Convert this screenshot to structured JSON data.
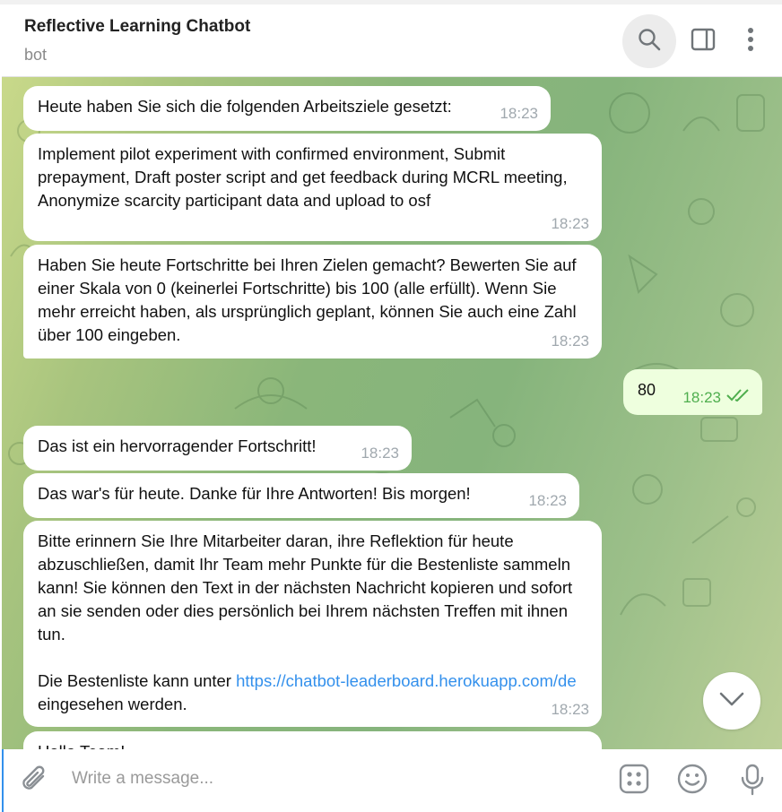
{
  "header": {
    "title": "Reflective Learning Chatbot",
    "subtitle": "bot",
    "icons": [
      "search-icon",
      "sidebar-toggle-icon",
      "more-options-icon"
    ]
  },
  "messages": [
    {
      "direction": "in",
      "text": "Heute haben Sie sich die folgenden Arbeitsziele gesetzt:",
      "time": "18:23"
    },
    {
      "direction": "in",
      "text": "Implement pilot experiment with confirmed environment, Submit prepayment, Draft poster script and get feedback during MCRL meeting, Anonymize scarcity participant data and upload to osf",
      "time": "18:23"
    },
    {
      "direction": "in",
      "text": "Haben Sie heute Fortschritte bei Ihren Zielen gemacht? Bewerten Sie auf einer Skala von 0 (keinerlei Fortschritte) bis 100 (alle erfüllt). Wenn Sie mehr erreicht haben, als ursprünglich geplant, können Sie auch eine Zahl über 100 eingeben.",
      "time": "18:23"
    },
    {
      "direction": "out",
      "text": "80",
      "time": "18:23",
      "status": "read"
    },
    {
      "direction": "in",
      "text": "Das ist ein hervorragender Fortschritt!",
      "time": "18:23"
    },
    {
      "direction": "in",
      "text": "Das war's für heute. Danke für Ihre Antworten! Bis morgen!",
      "time": "18:23"
    },
    {
      "direction": "in",
      "text": "Bitte erinnern Sie Ihre Mitarbeiter daran, ihre Reflektion für heute abzuschließen, damit Ihr Team mehr Punkte für die Bestenliste sammeln kann! Sie können den Text in der nächsten Nachricht kopieren und sofort an sie senden oder dies persönlich bei Ihrem nächsten Treffen mit ihnen tun.",
      "text2_pre": "Die Bestenliste kann unter ",
      "link": "https://chatbot-leaderboard.herokuapp.com/de",
      "text2_post": " eingesehen werden.",
      "time": "18:23"
    },
    {
      "direction": "in",
      "text": "Hallo Team!",
      "partial": true
    }
  ],
  "composer": {
    "placeholder": "Write a message...",
    "icons": [
      "paperclip-icon",
      "bot-commands-icon",
      "emoji-icon",
      "microphone-icon"
    ]
  },
  "colors": {
    "outgoing_bubble": "#eeffde",
    "incoming_bubble": "#ffffff",
    "link": "#3390ec",
    "read_check": "#4fae4e"
  }
}
